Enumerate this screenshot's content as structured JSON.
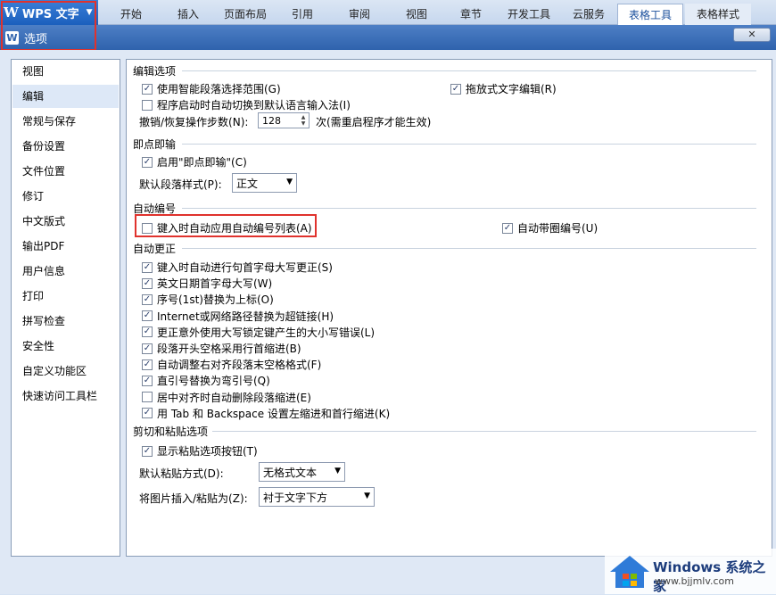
{
  "app": {
    "name": "WPS 文字"
  },
  "ribbon_tabs": [
    "开始",
    "插入",
    "页面布局",
    "引用",
    "审阅",
    "视图",
    "章节",
    "开发工具",
    "云服务",
    "表格工具",
    "表格样式"
  ],
  "dialog": {
    "title": "选项",
    "close_label": "✕"
  },
  "sidebar": {
    "items": [
      "视图",
      "编辑",
      "常规与保存",
      "备份设置",
      "文件位置",
      "修订",
      "中文版式",
      "输出PDF",
      "用户信息",
      "打印",
      "拼写检查",
      "安全性",
      "自定义功能区",
      "快速访问工具栏"
    ],
    "selected": "编辑"
  },
  "edit_options": {
    "section": "编辑选项",
    "smart_select": "使用智能段落选择范围(G)",
    "drag_drop": "拖放式文字编辑(R)",
    "auto_ime": "程序启动时自动切换到默认语言输入法(I)",
    "undo_label": "撤销/恢复操作步数(N):",
    "undo_value": "128",
    "undo_suffix": "次(需重启程序才能生效)"
  },
  "instant_input": {
    "section": "即点即输",
    "enable": "启用\"即点即输\"(C)",
    "default_style_label": "默认段落样式(P):",
    "default_style_value": "正文"
  },
  "auto_numbering": {
    "section": "自动编号",
    "auto_list": "键入时自动应用自动编号列表(A)",
    "auto_circled": "自动带圈编号(U)"
  },
  "auto_correct": {
    "section": "自动更正",
    "items": [
      {
        "label": "键入时自动进行句首字母大写更正(S)",
        "checked": true
      },
      {
        "label": "英文日期首字母大写(W)",
        "checked": true
      },
      {
        "label": "序号(1st)替换为上标(O)",
        "checked": true
      },
      {
        "label": "Internet或网络路径替换为超链接(H)",
        "checked": true
      },
      {
        "label": "更正意外使用大写锁定键产生的大小写错误(L)",
        "checked": true
      },
      {
        "label": "段落开头空格采用行首缩进(B)",
        "checked": true
      },
      {
        "label": "自动调整右对齐段落末空格格式(F)",
        "checked": true
      },
      {
        "label": "直引号替换为弯引号(Q)",
        "checked": true
      },
      {
        "label": "居中对齐时自动删除段落缩进(E)",
        "checked": false
      },
      {
        "label": "用 Tab 和 Backspace 设置左缩进和首行缩进(K)",
        "checked": true
      }
    ]
  },
  "cut_paste": {
    "section": "剪切和粘贴选项",
    "show_paste_btn": "显示粘贴选项按钮(T)",
    "default_paste_label": "默认粘贴方式(D):",
    "default_paste_value": "无格式文本",
    "insert_image_label": "将图片插入/粘贴为(Z):",
    "insert_image_value": "衬于文字下方"
  },
  "watermark": {
    "brand": "Windows 系统之家",
    "url": "www.bjjmlv.com"
  }
}
